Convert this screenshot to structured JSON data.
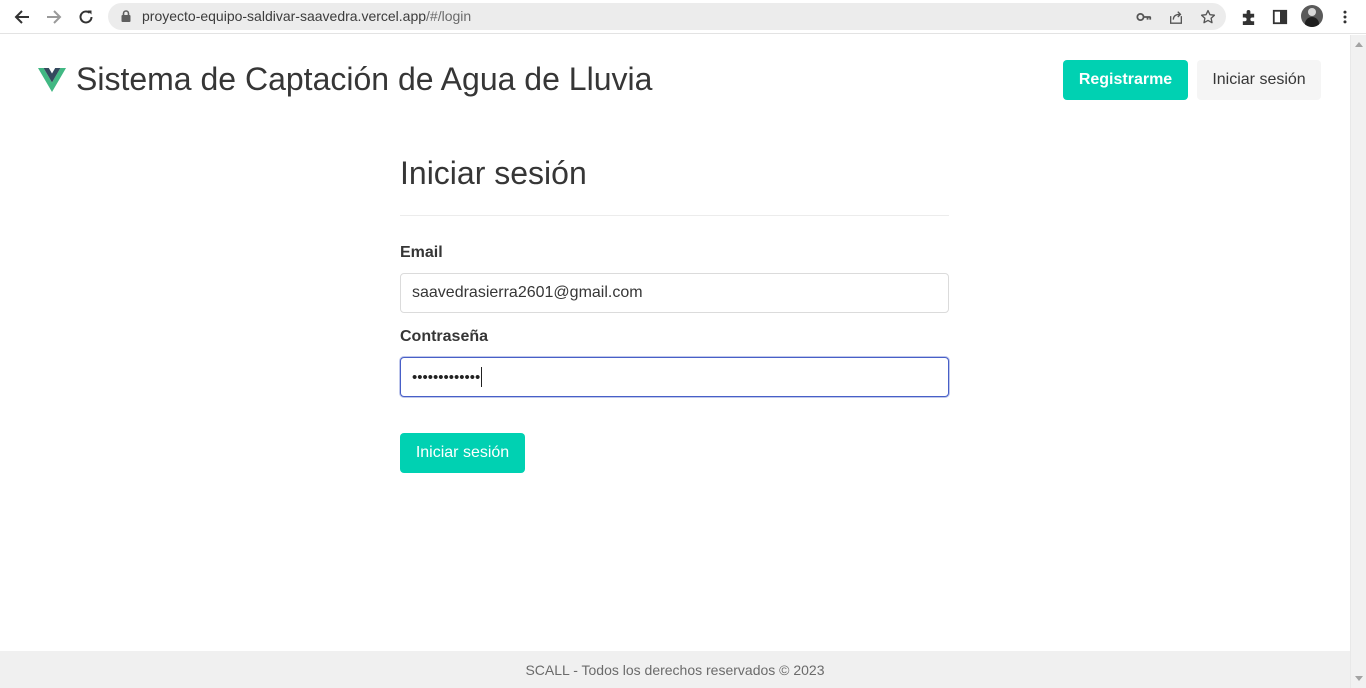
{
  "browser": {
    "url_host": "proyecto-equipo-saldivar-saavedra.vercel.app",
    "url_path": "/#/login",
    "icons": [
      "back-icon",
      "forward-icon",
      "reload-icon",
      "lock-icon",
      "key-icon",
      "share-icon",
      "star-icon",
      "extensions-icon",
      "side-panel-icon",
      "avatar",
      "more-icon"
    ]
  },
  "header": {
    "title": "Sistema de Captación de Agua de Lluvia",
    "register_label": "Registrarme",
    "login_label": "Iniciar sesión"
  },
  "form": {
    "title": "Iniciar sesión",
    "email_label": "Email",
    "email_value": "saavedrasierra2601@gmail.com",
    "password_label": "Contraseña",
    "password_value": "•••••••••••••",
    "submit_label": "Iniciar sesión"
  },
  "footer": {
    "text": "SCALL - Todos los derechos reservados © 2023"
  },
  "colors": {
    "primary": "#00d1b2",
    "focus": "#485fc7",
    "logo_green": "#41b883",
    "logo_dark": "#34495e"
  }
}
